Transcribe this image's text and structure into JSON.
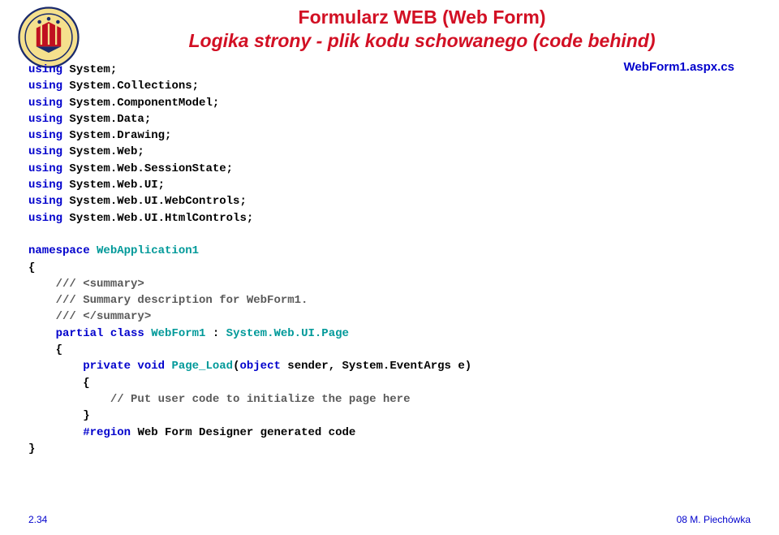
{
  "logo_alt": "Politechnika Gdańska seal",
  "title": {
    "line1": "Formularz WEB (Web Form)",
    "line2": "Logika strony - plik kodu schowanego (code behind)"
  },
  "filename": "WebForm1.aspx.cs",
  "code": {
    "u1a": "using",
    "u1b": " System;",
    "u2a": "using",
    "u2b": " System.Collections;",
    "u3a": "using",
    "u3b": " System.ComponentModel;",
    "u4a": "using",
    "u4b": " System.Data;",
    "u5a": "using",
    "u5b": " System.Drawing;",
    "u6a": "using",
    "u6b": " System.Web;",
    "u7a": "using",
    "u7b": " System.Web.SessionState;",
    "u8a": "using",
    "u8b": " System.Web.UI;",
    "u9a": "using",
    "u9b": " System.Web.UI.WebControls;",
    "u10a": "using",
    "u10b": " System.Web.UI.HtmlControls;",
    "ns_kw": "namespace ",
    "ns_name": "WebApplication1",
    "brace_open": "{",
    "c1": "    /// <summary>",
    "c2": "    /// Summary description for WebForm1.",
    "c3": "    /// </summary>",
    "cls_indent": "    ",
    "cls_kw1": "partial class ",
    "cls_name": "WebForm1",
    "cls_sep": " : ",
    "cls_base": "System.Web.UI.Page",
    "cls_brace_open": "    {",
    "m_indent": "        ",
    "m_vis": "private void ",
    "m_name": "Page_Load",
    "m_sig1": "(",
    "m_sig_kw": "object",
    "m_sig2": " sender, System.EventArgs e)",
    "m_brace_open": "        {",
    "m_comment": "            // Put user code to initialize the page here",
    "m_brace_close": "        }",
    "region_indent": "        ",
    "region": "#region ",
    "region_text": "Web Form Designer generated code",
    "brace_close": "}"
  },
  "footer": {
    "left": "2.34",
    "right": "08 M. Piechówka"
  }
}
